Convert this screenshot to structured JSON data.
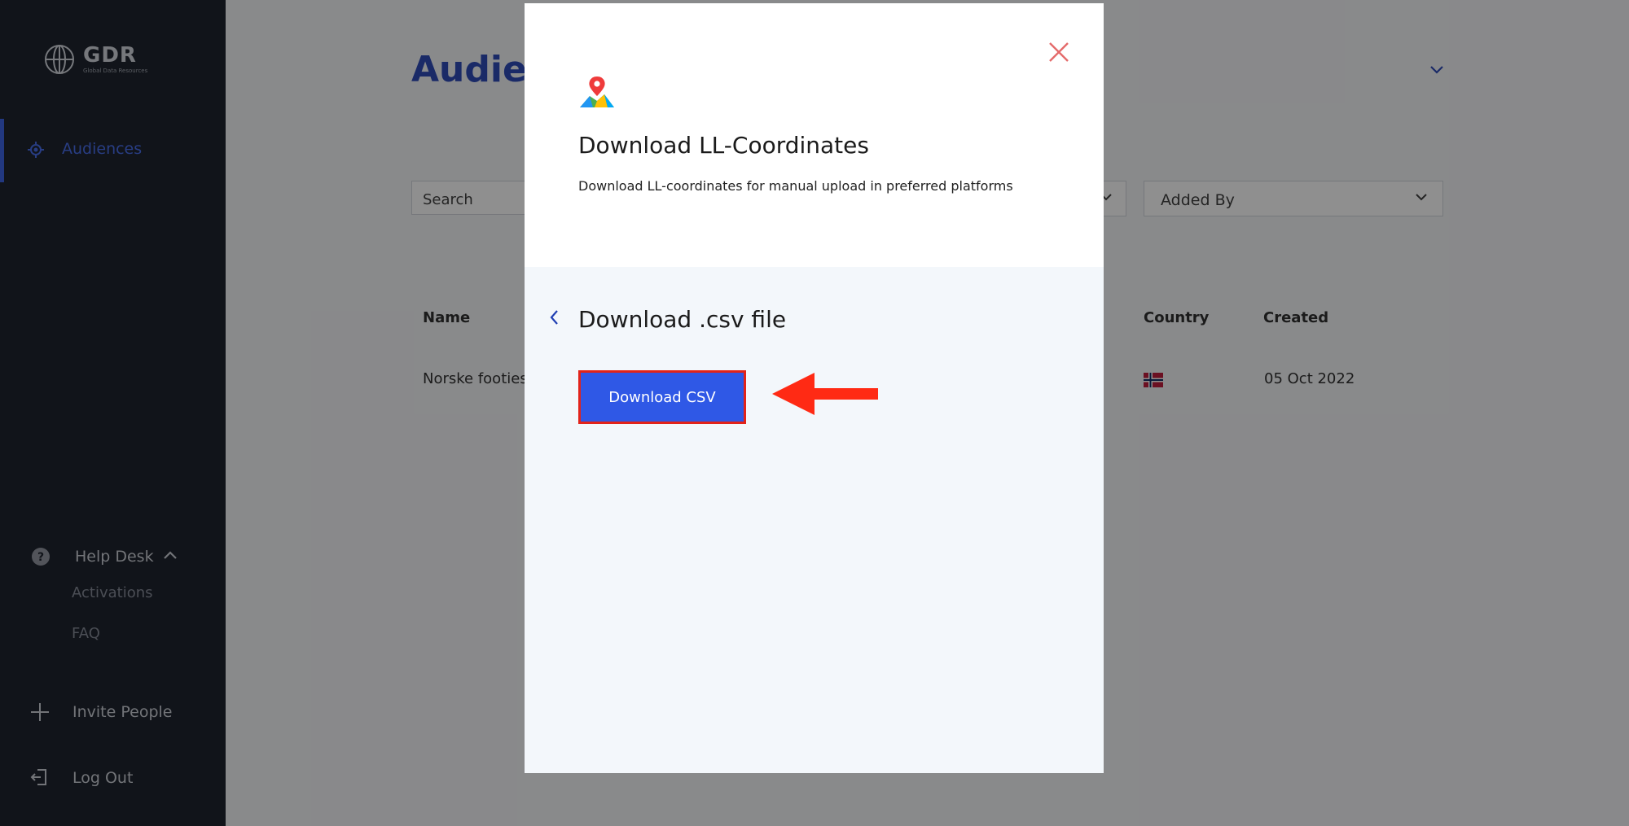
{
  "brand": {
    "name": "GDR",
    "tagline": "Global Data Resources"
  },
  "sidebar": {
    "nav": [
      {
        "label": "Audiences",
        "active": true
      }
    ],
    "help_desk": {
      "label": "Help Desk",
      "expanded": true,
      "items": [
        {
          "label": "Activations"
        },
        {
          "label": "FAQ"
        }
      ]
    },
    "invite": {
      "label": "Invite People"
    },
    "logout": {
      "label": "Log Out"
    }
  },
  "main": {
    "title": "Audien",
    "search": {
      "value": "Search"
    },
    "filters": {
      "added_by": "Added By"
    },
    "table": {
      "columns": [
        "Name",
        "Country",
        "Created"
      ],
      "rows": [
        {
          "name": "Norske footies",
          "country_flag": "norway-flag",
          "created": "05 Oct 2022"
        }
      ]
    }
  },
  "modal": {
    "title": "Download LL-Coordinates",
    "description": "Download LL-coordinates for manual upload in preferred platforms",
    "section_title": "Download .csv file",
    "download_button": "Download CSV",
    "icon": "map-pin-icon"
  },
  "colors": {
    "accent": "#2f58e6",
    "sidebar_bg": "#0f1420",
    "highlight_red": "#e2231a",
    "close_icon": "#e46a6a"
  }
}
